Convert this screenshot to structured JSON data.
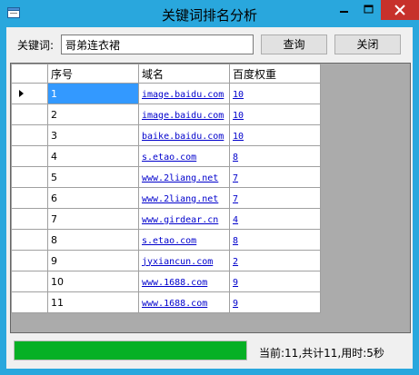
{
  "window": {
    "title": "关键词排名分析"
  },
  "search": {
    "label": "关键词:",
    "value": "哥弟连衣裙",
    "button": "查询",
    "close_button": "关闭"
  },
  "grid": {
    "columns": [
      "序号",
      "域名",
      "百度权重"
    ],
    "rows": [
      [
        "1",
        "image.baidu.com",
        "10"
      ],
      [
        "2",
        "image.baidu.com",
        "10"
      ],
      [
        "3",
        "baike.baidu.com",
        "10"
      ],
      [
        "4",
        "s.etao.com",
        "8"
      ],
      [
        "5",
        "www.2liang.net",
        "7"
      ],
      [
        "6",
        "www.2liang.net",
        "7"
      ],
      [
        "7",
        "www.girdear.cn",
        "4"
      ],
      [
        "8",
        "s.etao.com",
        "8"
      ],
      [
        "9",
        "jyxiancun.com",
        "2"
      ],
      [
        "10",
        "www.1688.com",
        "9"
      ],
      [
        "11",
        "www.1688.com",
        "9"
      ]
    ],
    "selected_row": 0
  },
  "progress": {
    "fraction": 1.0
  },
  "status": {
    "text": "当前:11,共计11,用时:5秒"
  },
  "colors": {
    "titlebar": "#29a7dd",
    "close": "#c7312b",
    "selection": "#3399ff",
    "progress": "#06b025"
  },
  "icons": [
    "app-icon",
    "minimize-icon",
    "maximize-icon",
    "close-icon",
    "current-row-arrow-icon"
  ]
}
